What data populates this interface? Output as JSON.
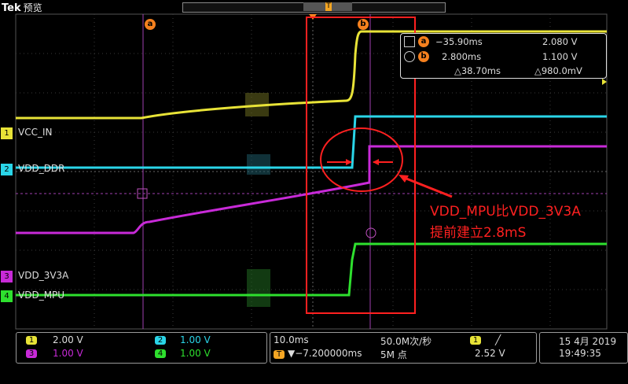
{
  "header": {
    "brand": "Tek",
    "mode": "预览"
  },
  "record_marker": "T",
  "cursor_markers": {
    "a": "a",
    "b": "b"
  },
  "cursor_readout": {
    "a": {
      "label": "a",
      "time": "−35.90ms",
      "value": "2.080 V"
    },
    "b": {
      "label": "b",
      "time": "2.800ms",
      "value": "1.100 V"
    },
    "delta": {
      "time": "△38.70ms",
      "value": "△980.0mV"
    }
  },
  "channels": [
    {
      "num": "1",
      "name": "VCC_IN",
      "color": "#e8e337",
      "scale": "2.00 V"
    },
    {
      "num": "2",
      "name": "VDD_DDR",
      "color": "#2ad5e8",
      "scale": "1.00 V"
    },
    {
      "num": "3",
      "name": "VDD_3V3A",
      "color": "#c82ad8",
      "scale": "1.00 V"
    },
    {
      "num": "4",
      "name": "VDD_MPU",
      "color": "#2ee02e",
      "scale": "1.00 V"
    }
  ],
  "annotation": {
    "line1": "VDD_MPU比VDD_3V3A",
    "line2": "提前建立2.8mS"
  },
  "horizontal": {
    "scale": "10.0ms",
    "sample_rate": "50.0M次/秒",
    "position": "▼−7.200000ms",
    "record_length": "5M 点"
  },
  "trigger": {
    "source": "1",
    "slope": "╱",
    "level": "2.52 V"
  },
  "datetime": {
    "date": "15 4月 2019",
    "time": "19:49:35"
  },
  "colors": {
    "accent_orange": "#f5801e",
    "annotation_red": "#ff2020",
    "grid": "#555555"
  }
}
